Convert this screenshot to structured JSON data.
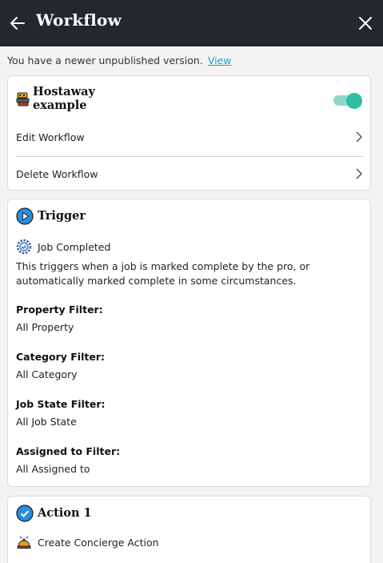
{
  "header": {
    "title": "Workflow"
  },
  "notice": {
    "text": "You have a newer unpublished version.",
    "link_label": "View"
  },
  "workflow_card": {
    "name": "Hostaway example",
    "enabled": true,
    "edit_label": "Edit Workflow",
    "delete_label": "Delete Workflow"
  },
  "trigger": {
    "title": "Trigger",
    "event_label": "Job Completed",
    "description": "This triggers when a job is marked complete by the pro, or automatically marked complete in some circumstances.",
    "filters": [
      {
        "label": "Property Filter:",
        "value": "All Property"
      },
      {
        "label": "Category Filter:",
        "value": "All Category"
      },
      {
        "label": "Job State Filter:",
        "value": "All Job State"
      },
      {
        "label": "Assigned to Filter:",
        "value": "All Assigned to"
      }
    ]
  },
  "action": {
    "title": "Action 1",
    "item_label": "Create Concierge Action"
  },
  "colors": {
    "header_bg": "#24272b",
    "accent": "#2ebfa5",
    "link": "#1aa3c4",
    "trigger_icon": "#2a8ee0"
  },
  "icons": {
    "back": "arrow-left-icon",
    "close": "close-icon",
    "workflow": "workflow-robot-icon",
    "trigger": "play-circle-icon",
    "job_completed": "gear-check-icon",
    "action": "check-circle-icon",
    "concierge": "concierge-bell-icon",
    "row_chevron": "chevron-right-icon"
  }
}
